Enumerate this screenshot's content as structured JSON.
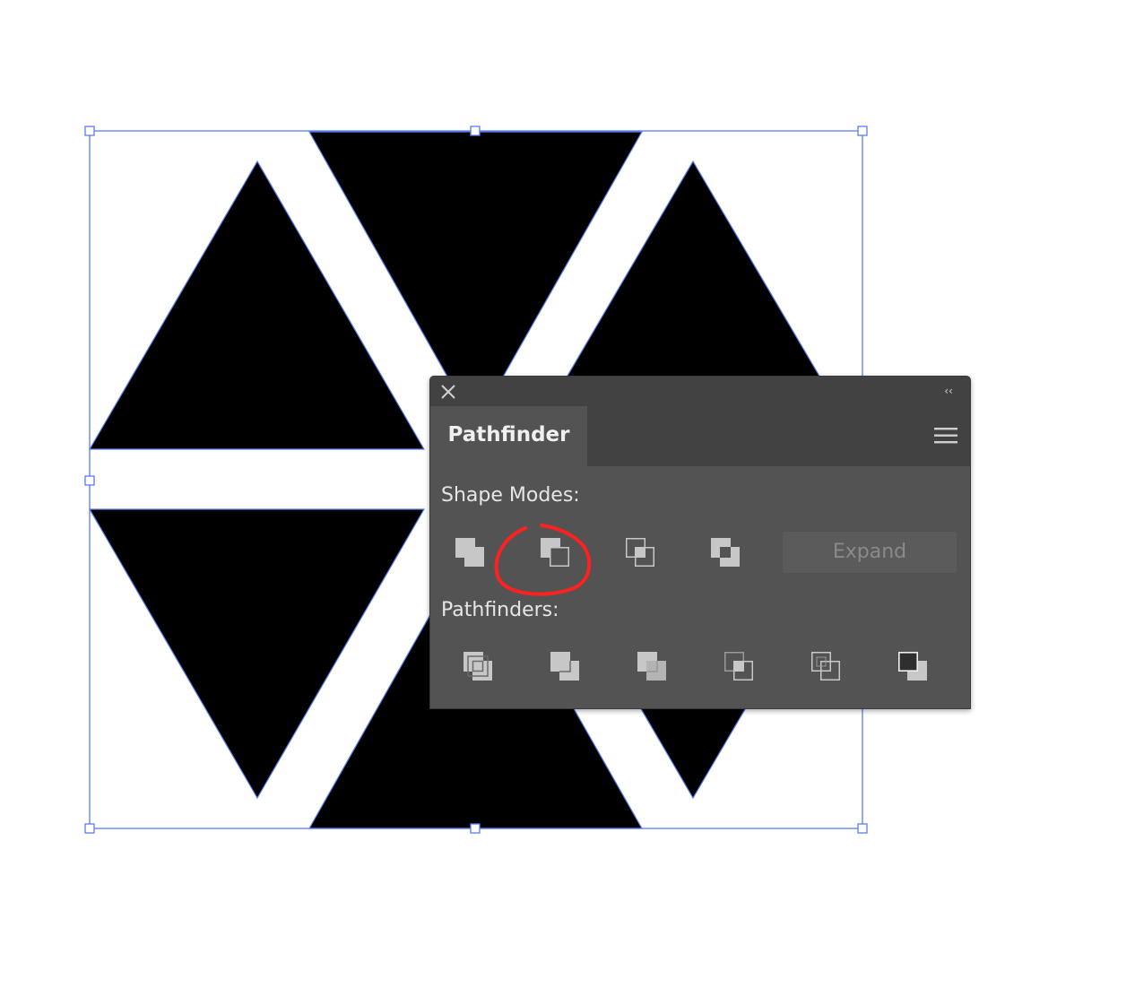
{
  "panel": {
    "tab_label": "Pathfinder",
    "collapse_glyph": "‹‹",
    "shape_modes_label": "Shape Modes:",
    "pathfinders_label": "Pathfinders:",
    "expand_label": "Expand",
    "expand_enabled": false,
    "shape_mode_buttons": [
      "unite-icon",
      "minus-front-icon",
      "intersect-icon",
      "exclude-icon"
    ],
    "pathfinder_buttons": [
      "divide-icon",
      "trim-icon",
      "merge-icon",
      "crop-icon",
      "outline-icon",
      "minus-back-icon"
    ],
    "highlighted_button": "minus-front-icon"
  },
  "colors": {
    "selection": "#5a7df0",
    "shape_fill": "#000000",
    "panel_bg": "#535353",
    "panel_header": "#424242",
    "annotation": "#ff2020"
  }
}
